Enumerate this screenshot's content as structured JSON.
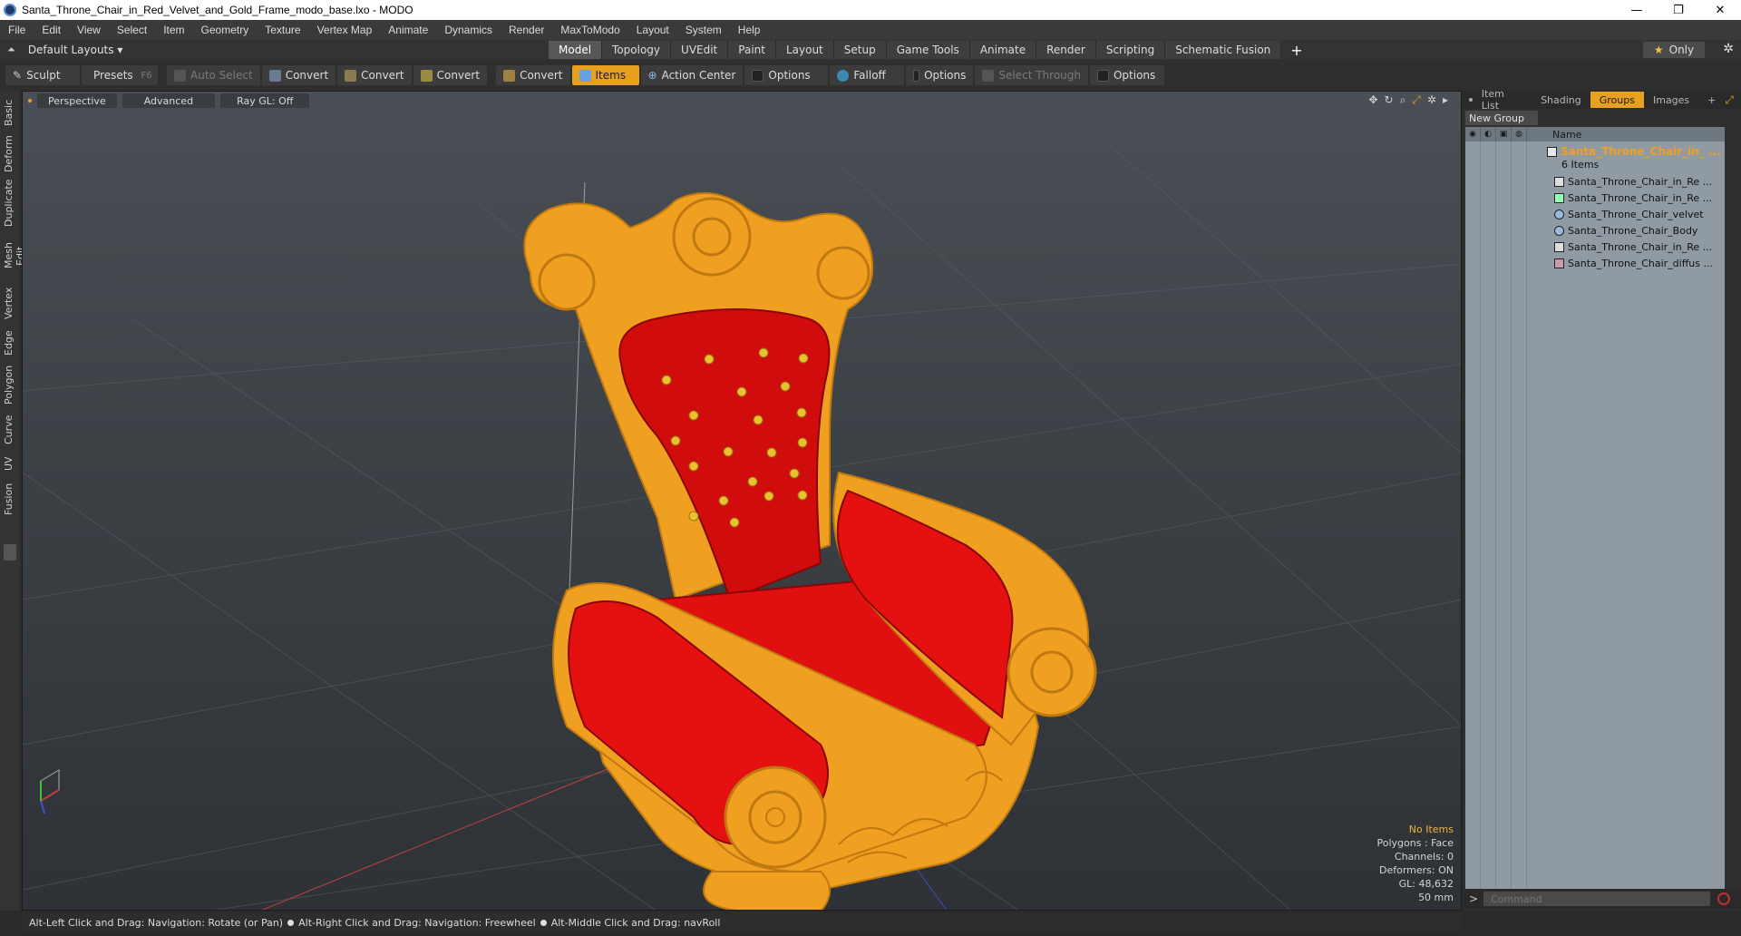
{
  "window": {
    "title": "Santa_Throne_Chair_in_Red_Velvet_and_Gold_Frame_modo_base.lxo - MODO",
    "minimize": "—",
    "maximize": "❐",
    "close": "✕"
  },
  "menu": [
    "File",
    "Edit",
    "View",
    "Select",
    "Item",
    "Geometry",
    "Texture",
    "Vertex Map",
    "Animate",
    "Dynamics",
    "Render",
    "MaxToModo",
    "Layout",
    "System",
    "Help"
  ],
  "layoutbar": {
    "layouts_label": "Default Layouts ▾",
    "tabs": [
      "Model",
      "Topology",
      "UVEdit",
      "Paint",
      "Layout",
      "Setup",
      "Game Tools",
      "Animate",
      "Render",
      "Scripting",
      "Schematic Fusion"
    ],
    "active_tab": "Model",
    "plus": "+",
    "only_label": "Only",
    "only_star": "★",
    "gear": "✲"
  },
  "toolbar": {
    "sculpt": "Sculpt",
    "presets": "Presets",
    "presets_hint": "F6",
    "auto_select": "Auto Select",
    "convert1": "Convert",
    "convert2": "Convert",
    "convert3": "Convert",
    "convert4": "Convert",
    "items": "Items",
    "action_center": "Action Center",
    "options1": "Options",
    "falloff": "Falloff",
    "options2": "Options",
    "select_through": "Select Through",
    "options3": "Options"
  },
  "lefttabs": [
    "Basic",
    "Deform",
    "Duplicate",
    "Mesh Edit",
    "Vertex",
    "Edge",
    "Polygon",
    "Curve",
    "UV",
    "Fusion"
  ],
  "viewport": {
    "view_mode": "Perspective",
    "shading": "Advanced",
    "raygl": "Ray GL: Off",
    "info": {
      "items": "No Items",
      "polygons": "Polygons : Face",
      "channels": "Channels: 0",
      "deformers": "Deformers: ON",
      "gl": "GL: 48,632",
      "scale": "50 mm"
    }
  },
  "statusbar": {
    "hint1": "Alt-Left Click and Drag: Navigation: Rotate (or Pan)",
    "hint2": "Alt-Right Click and Drag: Navigation: Freewheel",
    "hint3": "Alt-Middle Click and Drag: navRoll"
  },
  "rightpanel": {
    "tabs": [
      "Item List",
      "Shading",
      "Groups",
      "Images",
      "+"
    ],
    "active_tab": "Groups",
    "new_group": "New Group",
    "column_name": "Name",
    "group_name": "Santa_Throne_Chair_in_ ...",
    "group_count": "6 Items",
    "items": [
      "Santa_Throne_Chair_in_Re ...",
      "Santa_Throne_Chair_in_Re ...",
      "Santa_Throne_Chair_velvet",
      "Santa_Throne_Chair_Body",
      "Santa_Throne_Chair_in_Re ...",
      "Santa_Throne_Chair_diffus ..."
    ],
    "command_placeholder": "Command"
  },
  "colors": {
    "accent": "#e8a020",
    "gold": "#f0a020",
    "velvet": "#e01010"
  }
}
